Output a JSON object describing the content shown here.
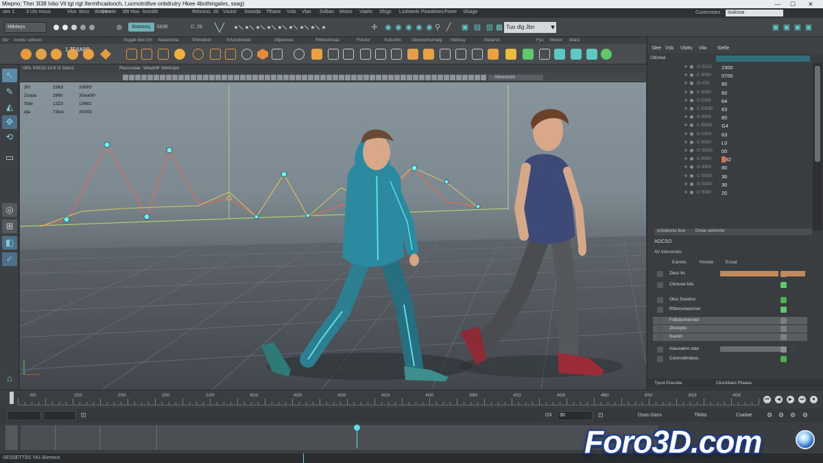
{
  "titlebar": {
    "title": "Miepno; Ther 3I38 Ivbo Vit tgt rigt ifermlhcadooch, I,ucmotrdtive onbdrutry Hkee 4bothingales, ssag)",
    "win_minimize": "—",
    "win_maximize": "☐",
    "win_close": "✕"
  },
  "menubar": {
    "items": [
      "oev 1",
      "3 UIs mouo",
      "Vlox",
      "Itoco",
      "Itlosnim",
      "Genolo",
      "ldtt Hoo",
      "lorzolitt",
      "Ifelorons. 30",
      "Vsuiot",
      "Soonda",
      "Tlhane",
      "Vslo",
      "Vlas",
      "Sslbas",
      "Mstos",
      "Viaels",
      "Shigs",
      "Lsoloeels",
      "Piseahoes",
      "Fiorer",
      "Slsage"
    ],
    "right_label": "Cuzecosies",
    "search_value": "Isuksna"
  },
  "statusline": {
    "mode": "Mtkiteys",
    "snap_label": "Botosvcj",
    "field_a": "S83E",
    "field_b": "C: 29",
    "workspace": "Tuo dlg Jbn"
  },
  "shelf": {
    "tabs": [
      "lbv",
      "ovobu",
      "uobuos",
      "Ssgab diwi Gn",
      "Aeiaossna",
      "Shtrodest",
      "Srtuvobiwiar",
      "Allpeorea",
      "Rhtiestnnaa",
      "Ftnulw",
      "Ssitunltn",
      "Oionoomumaig",
      "Vteiinsy",
      "Atetaros",
      "Fys",
      "Mcoor",
      "Ibaisi"
    ],
    "label": "1.T56A8S"
  },
  "viewport": {
    "menu": [
      "l3RL 53S1D",
      "13.8  I1 SdisS",
      "Reccnoaie",
      "Wtadsll",
      "Y",
      "Wtetropn"
    ],
    "panel_label": "Niesnccsin",
    "hud": [
      {
        "name": "3I0",
        "a": "2S63",
        "b": "3389S"
      },
      {
        "name": "Zsopa",
        "a": "2860",
        "b": "3Sea0l0"
      },
      {
        "name": "Sbie",
        "a": "13Z3",
        "b": "13683"
      },
      {
        "name": "qta",
        "a": "73tos",
        "b": "3S003"
      }
    ]
  },
  "channelbox": {
    "tabs": [
      "Slee",
      "Vsb",
      "Vlotts",
      "Vilo",
      "Slelle"
    ],
    "header": "Cltizred",
    "rows": [
      {
        "name": "G SCI3",
        "value": "2300"
      },
      {
        "name": "C 6050",
        "value": "0700"
      },
      {
        "name": "G IIS0",
        "value": "80"
      },
      {
        "name": "C 6050",
        "value": "60"
      },
      {
        "name": "G EI05",
        "value": "64"
      },
      {
        "name": "C SS0D",
        "value": "63"
      },
      {
        "name": "G 0000",
        "value": "80"
      },
      {
        "name": "C BIOD",
        "value": "G4"
      },
      {
        "name": "G 0000",
        "value": "63"
      },
      {
        "name": "C 0000",
        "value": "L0"
      },
      {
        "name": "G S0S0",
        "value": "00"
      },
      {
        "name": "C 0000",
        "value": "82"
      },
      {
        "name": "G 3000",
        "value": "80"
      },
      {
        "name": "C SS0S",
        "value": "36"
      },
      {
        "name": "G S000",
        "value": "30"
      },
      {
        "name": "C 0000",
        "value": "20"
      }
    ],
    "sub_left": "uniodectos liow",
    "sub_right": "Dmae uotsmnte"
  },
  "layers": {
    "title": "AOCSO",
    "subtitle": "AV Inbnsonbs",
    "tabs": [
      "Eanres",
      "Hnoste",
      "Ecoat"
    ],
    "rows": [
      {
        "name": "Zlesr Ils",
        "color": "#c08a5e"
      },
      {
        "name": "Clvnuse tuls",
        "color": "#5dc96b"
      },
      {
        "name": "Otsc Sxeelns",
        "color": "#4bb34f"
      },
      {
        "name": "Rftetcomesnnsr",
        "color": "#5dc96b"
      },
      {
        "name": "Fstbdcnnenotd",
        "color": "#7c8085"
      },
      {
        "name": "Zitutoplo",
        "color": "#7c8085"
      },
      {
        "name": "Suoorl",
        "color": "#7c8085"
      },
      {
        "name": "Aiauoatnn ctan",
        "color": "#8a8e92"
      },
      {
        "name": "Conmstlrrdeos",
        "color": "#4bb34f"
      }
    ],
    "foot_left": "Tyuot Elasstie",
    "foot_right": "Cksotiiaes Rtaaas"
  },
  "timeslider": {
    "labels": [
      "ItO",
      "2S3",
      "2S0",
      "2S0",
      "22I0",
      "4O3",
      "4O0",
      "4O0",
      "4O3",
      "4O0",
      "SB0",
      "4S3",
      "4O0",
      "4B0",
      "8S0",
      "8S3",
      "4O0"
    ],
    "playback": [
      "⏮",
      "◀",
      "▶",
      "⏭",
      "⏺"
    ]
  },
  "rangeslider": {
    "current_frame": "30",
    "fps_label": "Oxas Gans",
    "anim_label": "Tlkbts",
    "char_label": "Csatiae",
    "mid_field": "O3"
  },
  "commandline": {
    "text": "SESSETTSS YA1 Bumoco"
  },
  "watermark": {
    "text": "Foro3D.com"
  },
  "colors": {
    "accent": "#5ee0e6",
    "curve_red": "#e26b55",
    "curve_yellow": "#d6c760",
    "panel": "#3a3d40"
  }
}
